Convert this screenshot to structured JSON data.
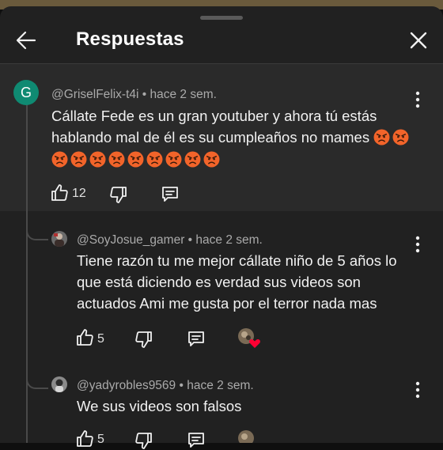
{
  "header": {
    "title": "Respuestas"
  },
  "comments": [
    {
      "author": "@GriselFelix-t4i",
      "time": "• hace 2 sem.",
      "avatar_letter": "G",
      "avatar_color": "#0f8a72",
      "text_line1": "Cállate Fede es un gran youtuber y ahora tú estás",
      "text_line2": "hablando mal de él es su cumpleaños no mames",
      "angry_emoji_count": 11,
      "likes": "12"
    },
    {
      "author": "@SoyJosue_gamer",
      "time": "• hace 2 sem.",
      "text_line1": "Tiene razón tu me mejor cállate niño de 5 años lo",
      "text_line2": "que está diciendo es verdad sus videos son",
      "text_line3": "actuados Ami me gusta por el terror nada mas",
      "likes": "5",
      "creator_heart": true
    },
    {
      "author": "@yadyrobles9569",
      "time": "• hace 2 sem.",
      "text_line1": "We sus videos son falsos",
      "likes": "5"
    }
  ],
  "colors": {
    "sheet_bg": "#212121",
    "highlight_bg": "#2a2a2a",
    "heart": "#ff0033"
  }
}
